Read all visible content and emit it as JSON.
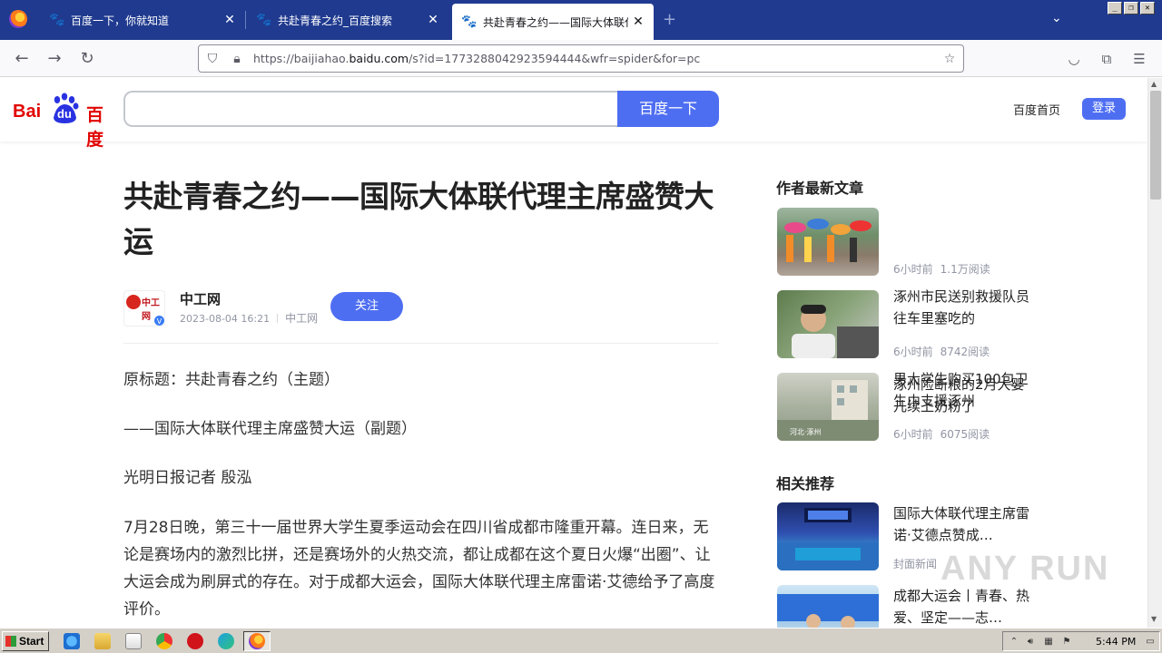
{
  "browser": {
    "tabs": [
      {
        "title": "百度一下，你就知道",
        "active": false
      },
      {
        "title": "共赴青春之约_百度搜索",
        "active": false
      },
      {
        "title": "共赴青春之约——国际大体联代理主席盛赞大运",
        "active": true
      }
    ],
    "url_prefix": "https://baijiahao.",
    "url_domain": "baidu.com",
    "url_rest": "/s?id=1773288042923594444&wfr=spider&for=pc",
    "window_controls": {
      "minimize": "_",
      "restore": "❐",
      "close": "✕"
    }
  },
  "header": {
    "logo_bai": "Bai",
    "logo_du": "du",
    "logo_cn": "百度",
    "search_value": "",
    "search_button": "百度一下",
    "home_link": "百度首页",
    "login_button": "登录"
  },
  "article": {
    "title": "共赴青春之约——国际大体联代理主席盛赞大运",
    "author": {
      "name": "中工网",
      "avatar_text": "中工网",
      "verified_badge": "V",
      "datetime": "2023-08-04 16:21",
      "source": "中工网",
      "follow_button": "关注"
    },
    "paragraphs": [
      "原标题：共赴青春之约（主题）",
      "——国际大体联代理主席盛赞大运（副题）",
      "光明日报记者 殷泓",
      "7月28日晚，第三十一届世界大学生夏季运动会在四川省成都市隆重开幕。连日来，无论是赛场内的激烈比拼，还是赛场外的火热交流，都让成都在这个夏日火爆“出圈”、让大运会成为刷屏式的存在。对于成都大运会，国际大体联代理主席雷诺·艾德给予了高度评价。"
    ]
  },
  "sidebar": {
    "latest_heading": "作者最新文章",
    "latest": [
      {
        "title": "涿州市民送别救援队员往车里塞吃的",
        "time": "6小时前",
        "reads": "1.1万阅读"
      },
      {
        "title": "男大学生购买100包卫生巾支援涿州",
        "time": "6小时前",
        "reads": "8742阅读"
      },
      {
        "title": "涿州险断粮的2月大婴儿续上奶粉了",
        "time": "6小时前",
        "reads": "6075阅读",
        "img_caption": "河北·涿州"
      }
    ],
    "related_heading": "相关推荐",
    "related": [
      {
        "title": "国际大体联代理主席雷诺·艾德点赞成…",
        "source": "封面新闻"
      },
      {
        "title": "成都大运会丨青春、热爱、坚定——志…"
      }
    ]
  },
  "watermark": "ANY RUN",
  "taskbar": {
    "start_label": "Start",
    "clock": "5:44 PM"
  },
  "colors": {
    "accent": "#4e6ef2",
    "baidu_red": "#e10602",
    "tab_strip": "#1f3a8f"
  }
}
